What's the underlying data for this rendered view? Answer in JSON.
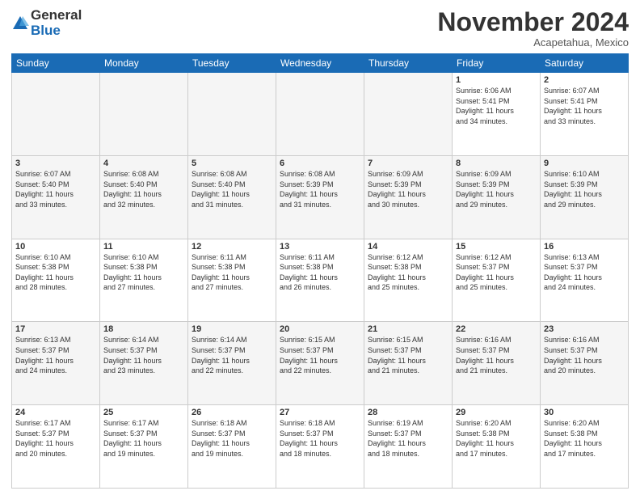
{
  "logo": {
    "general": "General",
    "blue": "Blue"
  },
  "header": {
    "month": "November 2024",
    "location": "Acapetahua, Mexico"
  },
  "weekdays": [
    "Sunday",
    "Monday",
    "Tuesday",
    "Wednesday",
    "Thursday",
    "Friday",
    "Saturday"
  ],
  "weeks": [
    [
      {
        "day": "",
        "info": "",
        "empty": true
      },
      {
        "day": "",
        "info": "",
        "empty": true
      },
      {
        "day": "",
        "info": "",
        "empty": true
      },
      {
        "day": "",
        "info": "",
        "empty": true
      },
      {
        "day": "",
        "info": "",
        "empty": true
      },
      {
        "day": "1",
        "info": "Sunrise: 6:06 AM\nSunset: 5:41 PM\nDaylight: 11 hours\nand 34 minutes."
      },
      {
        "day": "2",
        "info": "Sunrise: 6:07 AM\nSunset: 5:41 PM\nDaylight: 11 hours\nand 33 minutes."
      }
    ],
    [
      {
        "day": "3",
        "info": "Sunrise: 6:07 AM\nSunset: 5:40 PM\nDaylight: 11 hours\nand 33 minutes."
      },
      {
        "day": "4",
        "info": "Sunrise: 6:08 AM\nSunset: 5:40 PM\nDaylight: 11 hours\nand 32 minutes."
      },
      {
        "day": "5",
        "info": "Sunrise: 6:08 AM\nSunset: 5:40 PM\nDaylight: 11 hours\nand 31 minutes."
      },
      {
        "day": "6",
        "info": "Sunrise: 6:08 AM\nSunset: 5:39 PM\nDaylight: 11 hours\nand 31 minutes."
      },
      {
        "day": "7",
        "info": "Sunrise: 6:09 AM\nSunset: 5:39 PM\nDaylight: 11 hours\nand 30 minutes."
      },
      {
        "day": "8",
        "info": "Sunrise: 6:09 AM\nSunset: 5:39 PM\nDaylight: 11 hours\nand 29 minutes."
      },
      {
        "day": "9",
        "info": "Sunrise: 6:10 AM\nSunset: 5:39 PM\nDaylight: 11 hours\nand 29 minutes."
      }
    ],
    [
      {
        "day": "10",
        "info": "Sunrise: 6:10 AM\nSunset: 5:38 PM\nDaylight: 11 hours\nand 28 minutes."
      },
      {
        "day": "11",
        "info": "Sunrise: 6:10 AM\nSunset: 5:38 PM\nDaylight: 11 hours\nand 27 minutes."
      },
      {
        "day": "12",
        "info": "Sunrise: 6:11 AM\nSunset: 5:38 PM\nDaylight: 11 hours\nand 27 minutes."
      },
      {
        "day": "13",
        "info": "Sunrise: 6:11 AM\nSunset: 5:38 PM\nDaylight: 11 hours\nand 26 minutes."
      },
      {
        "day": "14",
        "info": "Sunrise: 6:12 AM\nSunset: 5:38 PM\nDaylight: 11 hours\nand 25 minutes."
      },
      {
        "day": "15",
        "info": "Sunrise: 6:12 AM\nSunset: 5:37 PM\nDaylight: 11 hours\nand 25 minutes."
      },
      {
        "day": "16",
        "info": "Sunrise: 6:13 AM\nSunset: 5:37 PM\nDaylight: 11 hours\nand 24 minutes."
      }
    ],
    [
      {
        "day": "17",
        "info": "Sunrise: 6:13 AM\nSunset: 5:37 PM\nDaylight: 11 hours\nand 24 minutes."
      },
      {
        "day": "18",
        "info": "Sunrise: 6:14 AM\nSunset: 5:37 PM\nDaylight: 11 hours\nand 23 minutes."
      },
      {
        "day": "19",
        "info": "Sunrise: 6:14 AM\nSunset: 5:37 PM\nDaylight: 11 hours\nand 22 minutes."
      },
      {
        "day": "20",
        "info": "Sunrise: 6:15 AM\nSunset: 5:37 PM\nDaylight: 11 hours\nand 22 minutes."
      },
      {
        "day": "21",
        "info": "Sunrise: 6:15 AM\nSunset: 5:37 PM\nDaylight: 11 hours\nand 21 minutes."
      },
      {
        "day": "22",
        "info": "Sunrise: 6:16 AM\nSunset: 5:37 PM\nDaylight: 11 hours\nand 21 minutes."
      },
      {
        "day": "23",
        "info": "Sunrise: 6:16 AM\nSunset: 5:37 PM\nDaylight: 11 hours\nand 20 minutes."
      }
    ],
    [
      {
        "day": "24",
        "info": "Sunrise: 6:17 AM\nSunset: 5:37 PM\nDaylight: 11 hours\nand 20 minutes."
      },
      {
        "day": "25",
        "info": "Sunrise: 6:17 AM\nSunset: 5:37 PM\nDaylight: 11 hours\nand 19 minutes."
      },
      {
        "day": "26",
        "info": "Sunrise: 6:18 AM\nSunset: 5:37 PM\nDaylight: 11 hours\nand 19 minutes."
      },
      {
        "day": "27",
        "info": "Sunrise: 6:18 AM\nSunset: 5:37 PM\nDaylight: 11 hours\nand 18 minutes."
      },
      {
        "day": "28",
        "info": "Sunrise: 6:19 AM\nSunset: 5:37 PM\nDaylight: 11 hours\nand 18 minutes."
      },
      {
        "day": "29",
        "info": "Sunrise: 6:20 AM\nSunset: 5:38 PM\nDaylight: 11 hours\nand 17 minutes."
      },
      {
        "day": "30",
        "info": "Sunrise: 6:20 AM\nSunset: 5:38 PM\nDaylight: 11 hours\nand 17 minutes."
      }
    ]
  ]
}
